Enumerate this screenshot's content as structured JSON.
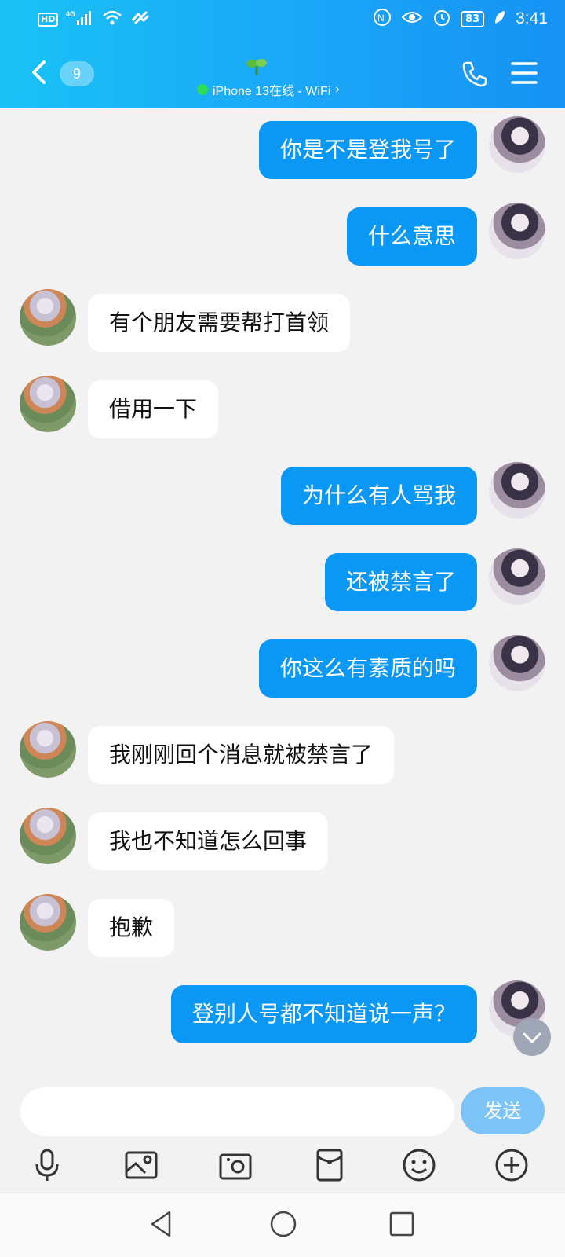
{
  "status_bar": {
    "hd": "HD",
    "network": "4G",
    "battery": "83",
    "time": "3:41"
  },
  "header": {
    "back_count": "9",
    "subtitle": "iPhone 13在线 - WiFi",
    "chevron": "›"
  },
  "messages": [
    {
      "side": "me",
      "text": "你是不是登我号了"
    },
    {
      "side": "me",
      "text": "什么意思"
    },
    {
      "side": "other",
      "text": "有个朋友需要帮打首领"
    },
    {
      "side": "other",
      "text": "借用一下"
    },
    {
      "side": "me",
      "text": "为什么有人骂我"
    },
    {
      "side": "me",
      "text": "还被禁言了"
    },
    {
      "side": "me",
      "text": "你这么有素质的吗"
    },
    {
      "side": "other",
      "text": "我刚刚回个消息就被禁言了"
    },
    {
      "side": "other",
      "text": "我也不知道怎么回事"
    },
    {
      "side": "other",
      "text": "抱歉"
    },
    {
      "side": "me",
      "text": "登别人号都不知道说一声？"
    }
  ],
  "composer": {
    "send_label": "发送"
  },
  "toolbar_icons": [
    "microphone-icon",
    "image-icon",
    "camera-icon",
    "red-packet-icon",
    "emoji-icon",
    "plus-icon"
  ],
  "colors": {
    "header": "#1aa6f8",
    "bubble_me": "#0b98f4",
    "bubble_other": "#ffffff",
    "send_button": "#7cc4f7",
    "online_dot": "#2fdc55"
  }
}
